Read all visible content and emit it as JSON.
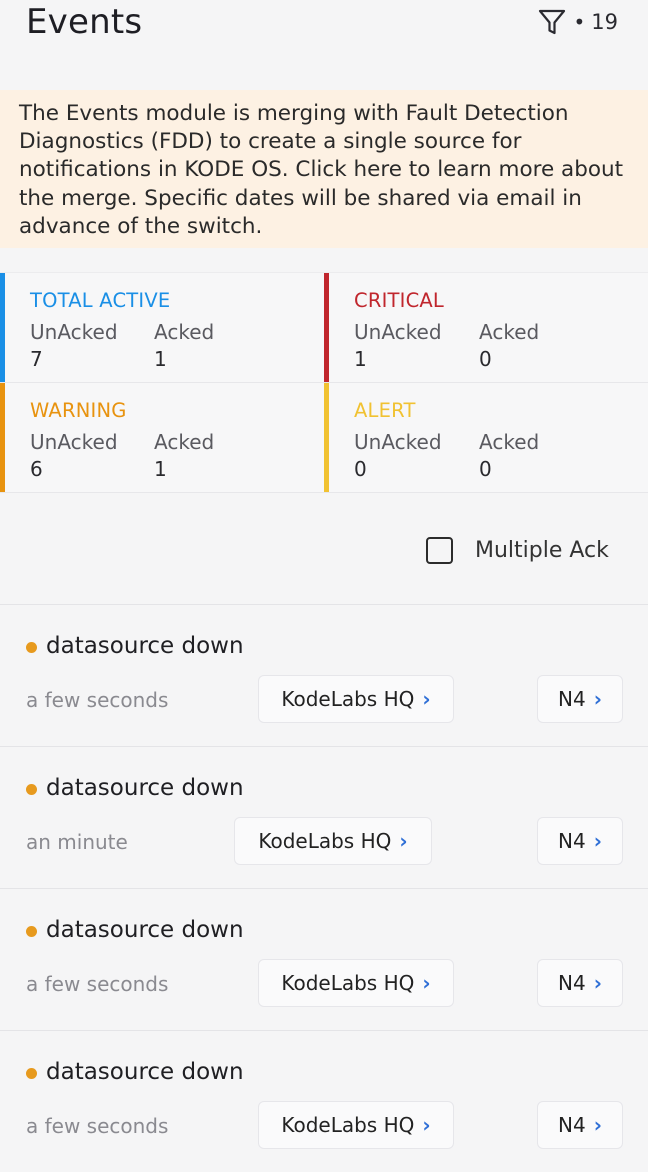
{
  "header": {
    "title": "Events",
    "filter_icon": "filter-icon",
    "filter_separator": "•",
    "filter_count": "19"
  },
  "banner": {
    "text": "The Events module is merging with Fault Detection Diagnostics (FDD) to create a single source for notifications in KODE OS. Click here to learn more about the merge. Specific dates will be shared via email in advance of the switch."
  },
  "stats": [
    {
      "label": "TOTAL ACTIVE",
      "color": "#1a8fe6",
      "unacked_label": "UnAcked",
      "acked_label": "Acked",
      "unacked": "7",
      "acked": "1"
    },
    {
      "label": "CRITICAL",
      "color": "#c0262d",
      "unacked_label": "UnAcked",
      "acked_label": "Acked",
      "unacked": "1",
      "acked": "0"
    },
    {
      "label": "WARNING",
      "color": "#e8930f",
      "unacked_label": "UnAcked",
      "acked_label": "Acked",
      "unacked": "6",
      "acked": "1"
    },
    {
      "label": "ALERT",
      "color": "#f1c232",
      "unacked_label": "UnAcked",
      "acked_label": "Acked",
      "unacked": "0",
      "acked": "0"
    }
  ],
  "multiple_ack": {
    "label": "Multiple Ack",
    "checked": false
  },
  "events": [
    {
      "name": "datasource down",
      "time": "a few seconds",
      "site": "KodeLabs HQ",
      "source": "N4",
      "severity_color": "#e79a1e"
    },
    {
      "name": "datasource down",
      "time": "an minute",
      "site": "KodeLabs HQ",
      "source": "N4",
      "severity_color": "#e79a1e"
    },
    {
      "name": "datasource down",
      "time": "a few seconds",
      "site": "KodeLabs HQ",
      "source": "N4",
      "severity_color": "#e79a1e"
    },
    {
      "name": "datasource down",
      "time": "a few seconds",
      "site": "KodeLabs HQ",
      "source": "N4",
      "severity_color": "#e79a1e"
    }
  ],
  "chevron": "›"
}
